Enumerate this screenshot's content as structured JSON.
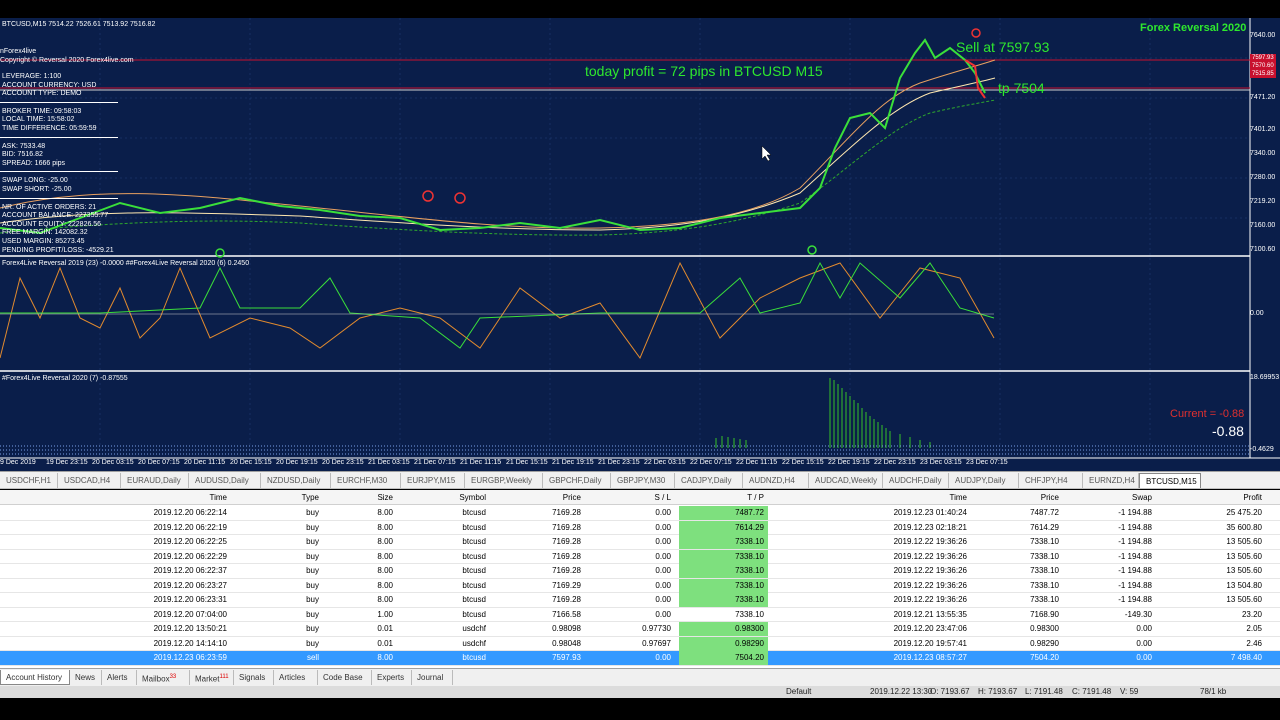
{
  "chart": {
    "symbol_line": "BTCUSD,M15  7514.22 7526.61 7513.92 7516.82",
    "brand": "nForex4live",
    "copyright": "Copyright © Reversal 2020 Forex4live.com",
    "title": "Forex Reversal 2020",
    "info_lines": [
      "LEVERAGE:   1:100",
      "ACCOUNT CURRENCY:   USD",
      "ACCOUNT TYPE:   DEMO",
      "",
      "BROKER TIME:   09:58:03",
      "LOCAL TIME:   15:58:02",
      "TIME DIFFERENCE:   05:59:59",
      "",
      "ASK:   7533.48",
      "BID:   7516.82",
      "SPREAD:   1666 pips",
      "",
      "SWAP LONG:   -25.00",
      "SWAP SHORT:   -25.00",
      "",
      "NR. OF ACTIVE ORDERS:   21",
      "ACCOUNT BALANCE:   227355.77",
      "ACCOUNT EQUITY:   222826.56",
      "FREE MARGIN:   142082.32",
      "USED MARGIN:   85273.45",
      "PENDING PROFIT/LOSS:   -4529.21"
    ],
    "annotation_profit": "today profit = 72 pips in BTCUSD M15",
    "annotation_sell": "Sell at 7597.93",
    "annotation_tp": "tp 7504",
    "indicator1_label": "Forex4Live Reversal 2019 (23) -0.0000  ##Forex4Live Reversal 2020 (6) 0.2450",
    "indicator2_label": "#Forex4Live Reversal 2020 (7) -0.87555",
    "current_label": "Current = -0.88",
    "current_value": "-0.88",
    "price_scale": [
      "7640.00",
      "7597.93",
      "7570.60",
      "7515.85",
      "7471.20",
      "7401.20",
      "7340.00",
      "7280.00",
      "7219.20",
      "7160.00",
      "7100.60"
    ],
    "ind1_scale": [
      "0.00"
    ],
    "ind2_scale": [
      "18.69953",
      "-0.4629"
    ],
    "time_labels": [
      "9 Dec 2019",
      "19 Dec 23:15",
      "20 Dec 03:15",
      "20 Dec 07:15",
      "20 Dec 11:15",
      "20 Dec 15:15",
      "20 Dec 19:15",
      "20 Dec 23:15",
      "21 Dec 03:15",
      "21 Dec 07:15",
      "21 Dec 11:15",
      "21 Dec 15:15",
      "21 Dec 19:15",
      "21 Dec 23:15",
      "22 Dec 03:15",
      "22 Dec 07:15",
      "22 Dec 11:15",
      "22 Dec 15:15",
      "22 Dec 19:15",
      "22 Dec 23:15",
      "23 Dec 03:15",
      "23 Dec 07:15"
    ]
  },
  "chart_tabs": [
    "USDCHF,H1",
    "USDCAD,H4",
    "EURAUD,Daily",
    "AUDUSD,Daily",
    "NZDUSD,Daily",
    "EURCHF,M30",
    "EURJPY,M15",
    "EURGBP,Weekly",
    "GBPCHF,Daily",
    "GBPJPY,M30",
    "CADJPY,Daily",
    "AUDNZD,H4",
    "AUDCAD,Weekly",
    "AUDCHF,Daily",
    "AUDJPY,Daily",
    "CHFJPY,H4",
    "EURNZD,H4",
    "BTCUSD,M15"
  ],
  "table": {
    "headers": [
      "Time",
      "Type",
      "Size",
      "Symbol",
      "Price",
      "S / L",
      "T / P",
      "Time",
      "Price",
      "Swap",
      "Profit"
    ],
    "rows": [
      [
        "2019.12.20 06:22:14",
        "buy",
        "8.00",
        "btcusd",
        "7169.28",
        "0.00",
        "7487.72",
        "2019.12.23 01:40:24",
        "7487.72",
        "-1 194.88",
        "25 475.20"
      ],
      [
        "2019.12.20 06:22:19",
        "buy",
        "8.00",
        "btcusd",
        "7169.28",
        "0.00",
        "7614.29",
        "2019.12.23 02:18:21",
        "7614.29",
        "-1 194.88",
        "35 600.80"
      ],
      [
        "2019.12.20 06:22:25",
        "buy",
        "8.00",
        "btcusd",
        "7169.28",
        "0.00",
        "7338.10",
        "2019.12.22 19:36:26",
        "7338.10",
        "-1 194.88",
        "13 505.60"
      ],
      [
        "2019.12.20 06:22:29",
        "buy",
        "8.00",
        "btcusd",
        "7169.28",
        "0.00",
        "7338.10",
        "2019.12.22 19:36:26",
        "7338.10",
        "-1 194.88",
        "13 505.60"
      ],
      [
        "2019.12.20 06:22:37",
        "buy",
        "8.00",
        "btcusd",
        "7169.28",
        "0.00",
        "7338.10",
        "2019.12.22 19:36:26",
        "7338.10",
        "-1 194.88",
        "13 505.60"
      ],
      [
        "2019.12.20 06:23:27",
        "buy",
        "8.00",
        "btcusd",
        "7169.29",
        "0.00",
        "7338.10",
        "2019.12.22 19:36:26",
        "7338.10",
        "-1 194.88",
        "13 504.80"
      ],
      [
        "2019.12.20 06:23:31",
        "buy",
        "8.00",
        "btcusd",
        "7169.28",
        "0.00",
        "7338.10",
        "2019.12.22 19:36:26",
        "7338.10",
        "-1 194.88",
        "13 505.60"
      ],
      [
        "2019.12.20 07:04:00",
        "buy",
        "1.00",
        "btcusd",
        "7166.58",
        "0.00",
        "7338.10",
        "2019.12.21 13:55:35",
        "7168.90",
        "-149.30",
        "23.20"
      ],
      [
        "2019.12.20 13:50:21",
        "buy",
        "0.01",
        "usdchf",
        "0.98098",
        "0.97730",
        "0.98300",
        "2019.12.20 23:47:06",
        "0.98300",
        "0.00",
        "2.05"
      ],
      [
        "2019.12.20 14:14:10",
        "buy",
        "0.01",
        "usdchf",
        "0.98048",
        "0.97697",
        "0.98290",
        "2019.12.20 19:57:41",
        "0.98290",
        "0.00",
        "2.46"
      ],
      [
        "2019.12.23 06:23:59",
        "sell",
        "8.00",
        "btcusd",
        "7597.93",
        "0.00",
        "7504.20",
        "2019.12.23 08:57:27",
        "7504.20",
        "0.00",
        "7 498.40"
      ]
    ],
    "tp_highlight": [
      true,
      true,
      true,
      true,
      true,
      true,
      true,
      false,
      true,
      true,
      true
    ]
  },
  "bottom_tabs": [
    {
      "label": "Account History",
      "badge": ""
    },
    {
      "label": "News",
      "badge": ""
    },
    {
      "label": "Alerts",
      "badge": ""
    },
    {
      "label": "Mailbox",
      "badge": "33"
    },
    {
      "label": "Market",
      "badge": "111"
    },
    {
      "label": "Signals",
      "badge": ""
    },
    {
      "label": "Articles",
      "badge": ""
    },
    {
      "label": "Code Base",
      "badge": ""
    },
    {
      "label": "Experts",
      "badge": ""
    },
    {
      "label": "Journal",
      "badge": ""
    }
  ],
  "status": {
    "profile": "Default",
    "datetime": "2019.12.22 13:30",
    "open": "O: 7193.67",
    "high": "H: 7193.67",
    "low": "L: 7191.48",
    "close": "C: 7191.48",
    "volume": "V: 59",
    "traffic": "78/1 kb"
  }
}
